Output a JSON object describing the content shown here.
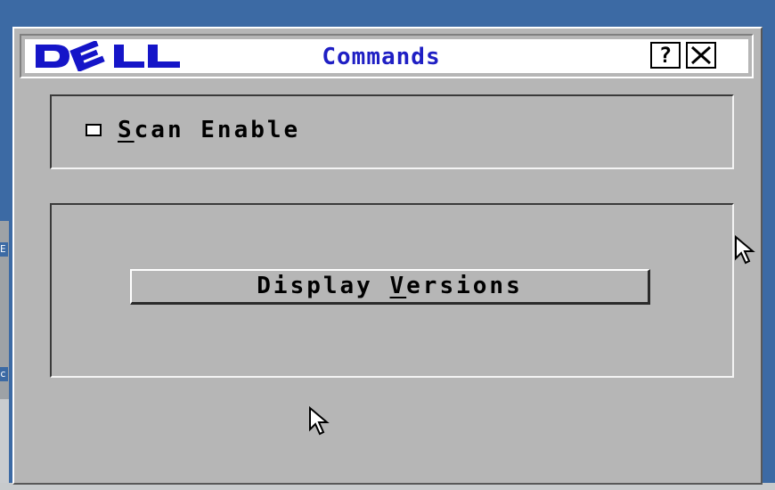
{
  "window": {
    "brand_logo_text": "DELL",
    "title": "Commands",
    "help_button_label": "?",
    "close_button_icon": "close-icon"
  },
  "scan_panel": {
    "checkbox_label_mnemonic": "S",
    "checkbox_label_rest": "can Enable",
    "checked": false
  },
  "versions_panel": {
    "button_label_prefix": "Display ",
    "button_label_mnemonic": "V",
    "button_label_rest": "ersions"
  },
  "background_fragments": {
    "left_top": "E",
    "left_bottom": "c"
  },
  "colors": {
    "desktop": "#3c6aa4",
    "window_face": "#b6b6b6",
    "title_text": "#1f1fc4",
    "logo": "#1515c8"
  },
  "icons": [
    "dell-logo-icon",
    "close-icon",
    "mouse-pointer-icon"
  ]
}
